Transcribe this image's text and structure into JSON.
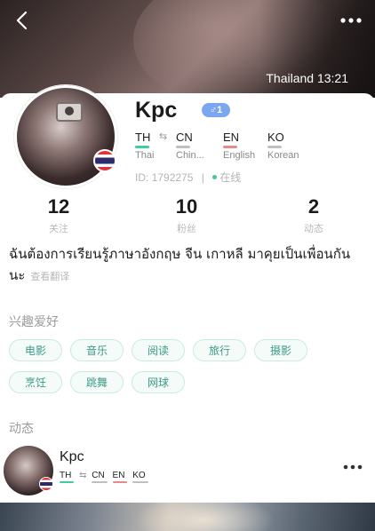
{
  "header": {
    "location_time": "Thailand 13:21"
  },
  "profile": {
    "username": "Kpc",
    "gender_badge": "♂1",
    "languages": [
      {
        "code": "TH",
        "name": "Thai",
        "color": "#44c9a1"
      },
      {
        "code": "CN",
        "name": "Chin...",
        "color": "#bfbfbf"
      },
      {
        "code": "EN",
        "name": "English",
        "color": "#e88a8a"
      },
      {
        "code": "KO",
        "name": "Korean",
        "color": "#bfbfbf"
      }
    ],
    "swap_symbol": "⇆",
    "id_text": "ID: 1792275",
    "id_divider": "|",
    "online_text": "在线"
  },
  "stats": [
    {
      "value": "12",
      "label": "关注"
    },
    {
      "value": "10",
      "label": "粉丝"
    },
    {
      "value": "2",
      "label": "动态"
    }
  ],
  "bio": {
    "text": "ฉันต้องการเรียนรู้ภาษาอังกฤษ จีน เกาหลี มาคุยเป็นเพื่อนกันนะ",
    "translate_label": "查看翻译"
  },
  "interests": {
    "title": "兴趣爱好",
    "tags": [
      "电影",
      "音乐",
      "阅读",
      "旅行",
      "摄影",
      "烹饪",
      "跳舞",
      "网球"
    ]
  },
  "moments": {
    "title": "动态",
    "post": {
      "username": "Kpc",
      "languages": [
        "TH",
        "CN",
        "EN",
        "KO"
      ],
      "swap_symbol": "⇆"
    }
  },
  "colors": {
    "accent": "#3d9a86",
    "tag_border": "#c8ecdf",
    "badge": "#7aa6f2"
  },
  "icons": [
    "back-arrow-icon",
    "more-dots-icon",
    "camera-icon",
    "thailand-flag-icon",
    "male-icon",
    "online-dot-icon"
  ]
}
